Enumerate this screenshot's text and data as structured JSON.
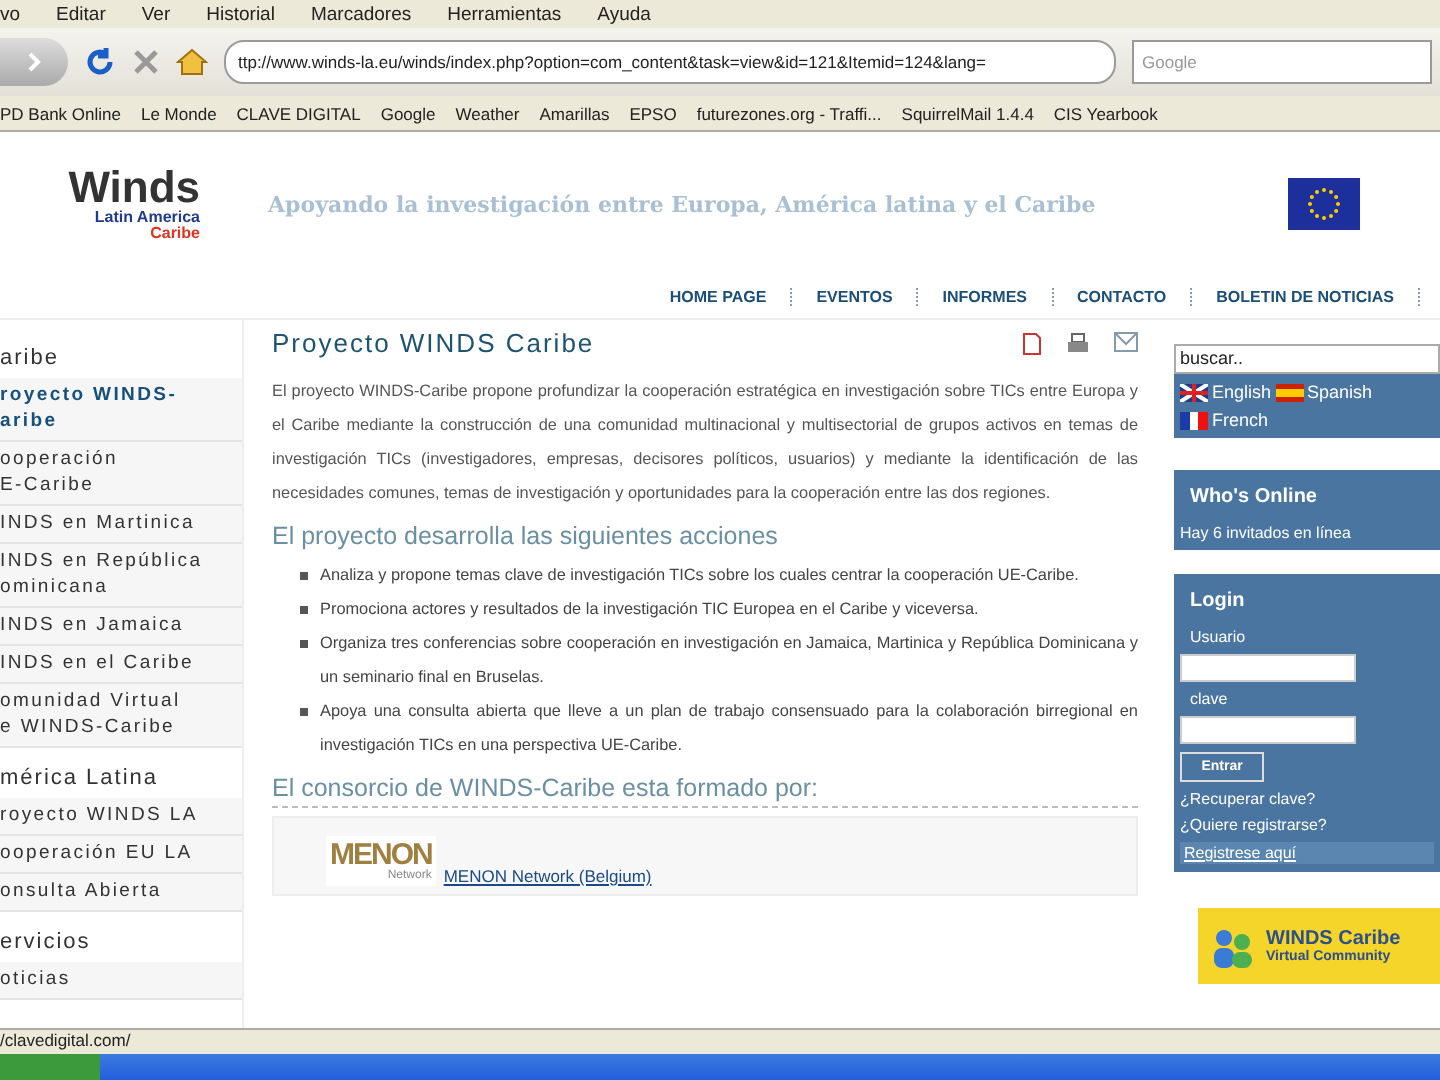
{
  "browser": {
    "menu": [
      "vo",
      "Editar",
      "Ver",
      "Historial",
      "Marcadores",
      "Herramientas",
      "Ayuda"
    ],
    "url": "ttp://www.winds-la.eu/winds/index.php?option=com_content&task=view&id=121&Itemid=124&lang=",
    "search": {
      "placeholder": "Google"
    },
    "bookmarks": [
      "PD Bank Online",
      "Le Monde",
      "CLAVE DIGITAL",
      "Google",
      "Weather",
      "Amarillas",
      "EPSO",
      "futurezones.org - Traffi...",
      "SquirrelMail 1.4.4",
      "CIS Yearbook"
    ],
    "status": "/clavedigital.com/"
  },
  "header": {
    "logo": {
      "title": "Winds",
      "line_1": "Latin America",
      "line_2": "Caribe"
    },
    "tagline": "Apoyando la investigación entre Europa, América latina y el Caribe"
  },
  "nav": [
    "HOME PAGE",
    "EVENTOS",
    "INFORMES",
    "CONTACTO",
    "BOLETIN DE NOTICIAS"
  ],
  "sidebar": {
    "sections": [
      {
        "heading": "aribe",
        "items": [
          {
            "lines": [
              "royecto WINDS-",
              "aribe"
            ],
            "selected": true
          },
          {
            "lines": [
              "ooperación",
              "E-Caribe"
            ],
            "selected": false
          },
          {
            "lines": [
              "INDS en Martinica"
            ],
            "selected": false
          },
          {
            "lines": [
              "INDS en República",
              "ominicana"
            ],
            "selected": false
          },
          {
            "lines": [
              "INDS en Jamaica"
            ],
            "selected": false
          },
          {
            "lines": [
              "INDS en el Caribe"
            ],
            "selected": false
          },
          {
            "lines": [
              "omunidad Virtual",
              "e WINDS-Caribe"
            ],
            "selected": false
          }
        ]
      },
      {
        "heading": "mérica Latina",
        "items": [
          {
            "lines": [
              "royecto WINDS LA"
            ],
            "selected": false
          },
          {
            "lines": [
              "ooperación EU LA"
            ],
            "selected": false
          },
          {
            "lines": [
              "onsulta Abierta"
            ],
            "selected": false
          }
        ]
      },
      {
        "heading": "ervicios",
        "items": [
          {
            "lines": [
              "oticias"
            ],
            "selected": false
          }
        ]
      }
    ]
  },
  "article": {
    "title": "Proyecto WINDS Caribe",
    "intro": "El proyecto WINDS-Caribe propone profundizar la cooperación estratégica en investigación sobre TICs entre Europa y el Caribe mediante la construcción de una comunidad multinacional y multisectorial de grupos activos en temas de investigación TICs (investigadores, empresas, decisores políticos, usuarios) y mediante la identificación de las necesidades comunes, temas de investigación y oportunidades para la cooperación entre las dos regiones.",
    "actions_heading": "El proyecto desarrolla las siguientes acciones",
    "actions": [
      "Analiza y propone temas clave de investigación TICs sobre los cuales centrar la cooperación UE-Caribe.",
      "Promociona actores y resultados de la investigación TIC Europea en el Caribe y viceversa.",
      "Organiza tres conferencias sobre cooperación en investigación en Jamaica, Martinica y República Dominicana y un seminario final en Bruselas.",
      "Apoya una consulta abierta que lleve a un plan de trabajo consensuado para la colaboración birregional en investigación TICs en una perspectiva UE-Caribe."
    ],
    "consortium_heading": "El consorcio de WINDS-Caribe esta formado por:",
    "partner": {
      "logo": "MENON",
      "logo_sub": "Network",
      "link": "MENON Network (Belgium)"
    }
  },
  "right": {
    "search": {
      "value": "buscar.."
    },
    "languages": [
      "English",
      "Spanish",
      "French"
    ],
    "whos_online": {
      "title": "Who's Online",
      "text": "Hay 6 invitados en línea"
    },
    "login": {
      "title": "Login",
      "user_label": "Usuario",
      "password_label": "clave",
      "button": "Entrar",
      "links": [
        "¿Recuperar clave?",
        "¿Quiere registrarse?"
      ],
      "register": "Registrese aquí"
    },
    "banner": {
      "title": "WINDS Caribe",
      "subtitle": "Virtual Community"
    }
  }
}
